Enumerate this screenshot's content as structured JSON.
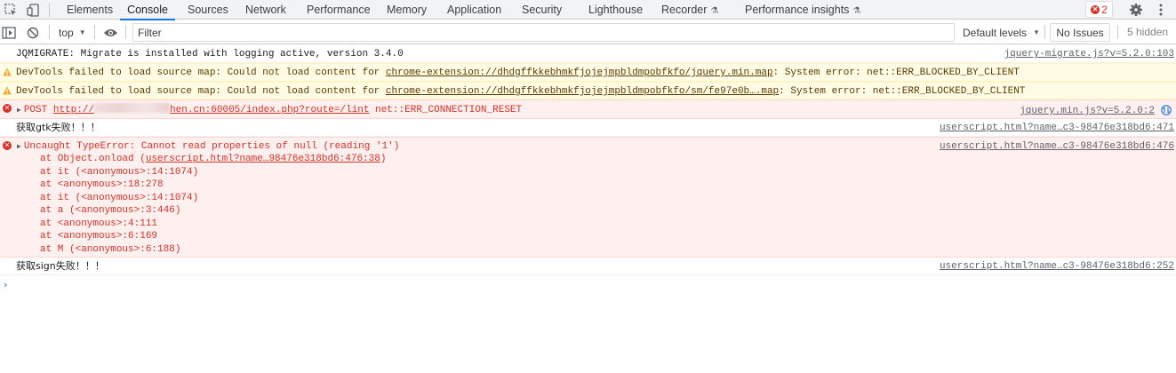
{
  "tabs": [
    {
      "label": "Elements"
    },
    {
      "label": "Console"
    },
    {
      "label": "Sources"
    },
    {
      "label": "Network"
    },
    {
      "label": "Performance"
    },
    {
      "label": "Memory"
    },
    {
      "label": "Application"
    },
    {
      "label": "Security"
    },
    {
      "label": "Lighthouse"
    },
    {
      "label": "Recorder"
    },
    {
      "label": "Performance insights"
    }
  ],
  "error_count": "2",
  "filterbar": {
    "context": "top",
    "filter_placeholder": "Filter",
    "levels": "Default levels",
    "issues": "No Issues",
    "hidden": "5 hidden"
  },
  "messages": {
    "m1": {
      "text": "JQMIGRATE: Migrate is installed with logging active, version 3.4.0",
      "source": "jquery-migrate.js?v=5.2.0:103"
    },
    "m2": {
      "pre": "DevTools failed to load source map: Could not load content for ",
      "link": "chrome-extension://dhdgffkkebhmkfjojejmpbldmpobfkfo/jquery.min.map",
      "post": ": System error: net::ERR_BLOCKED_BY_CLIENT"
    },
    "m3": {
      "pre": "DevTools failed to load source map: Could not load content for ",
      "link": "chrome-extension://dhdgffkkebhmkfjojejmpbldmpobfkfo/sm/fe97e0b….map",
      "post": ": System error: net::ERR_BLOCKED_BY_CLIENT"
    },
    "m4": {
      "method": "POST",
      "url_start": "http://",
      "url_end": "hen.cn:60005/index.php?route=/lint",
      "error": "net::ERR_CONNECTION_RESET",
      "source": "jquery.min.js?v=5.2.0:2"
    },
    "m5": {
      "text": "获取gtk失败！！！",
      "source": "userscript.html?name…c3-98476e318bd6:471"
    },
    "m6": {
      "text": "Uncaught TypeError: Cannot read properties of null (reading '1')",
      "source": "userscript.html?name…c3-98476e318bd6:476",
      "stack_first_pre": "at Object.onload (",
      "stack_first_link": "userscript.html?name…98476e318bd6:476:38",
      "stack_first_post": ")",
      "stack": [
        "at it (<anonymous>:14:1074)",
        "at <anonymous>:18:278",
        "at it (<anonymous>:14:1074)",
        "at a (<anonymous>:3:446)",
        "at <anonymous>:4:111",
        "at <anonymous>:6:169",
        "at M (<anonymous>:6:188)"
      ]
    },
    "m7": {
      "text": "获取sign失败！！！",
      "source": "userscript.html?name…c3-98476e318bd6:252"
    }
  },
  "prompt": "›"
}
